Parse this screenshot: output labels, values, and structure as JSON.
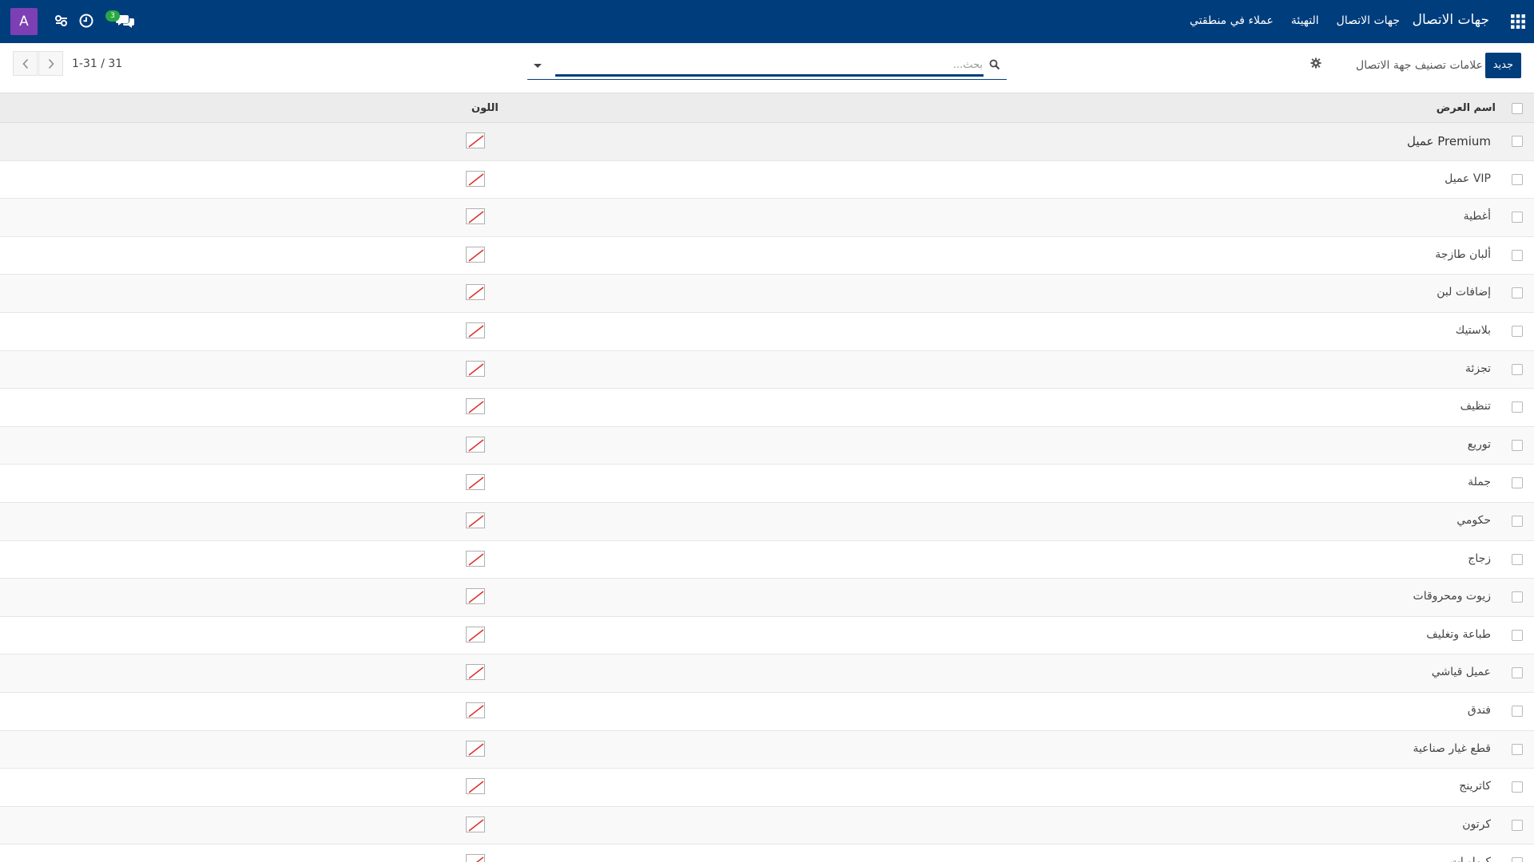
{
  "navbar": {
    "app_title": "جهات الاتصال",
    "menu": [
      {
        "label": "جهات الاتصال"
      },
      {
        "label": "التهيئة"
      },
      {
        "label": "عملاء في منطقتي"
      }
    ],
    "user_initial": "A",
    "chat_badge_count": "3",
    "icons": [
      "apps-grid-icon",
      "chat-icon",
      "clock-icon",
      "sliders-icon"
    ]
  },
  "control_panel": {
    "new_button": "جديد",
    "breadcrumb": "علامات تصنيف جهة الاتصال",
    "search_placeholder": "بحث...",
    "pager_text": "1-31 / 31"
  },
  "list": {
    "columns": {
      "display_name": "اسم العرض",
      "color": "اللون"
    },
    "rows": [
      {
        "name": "عميل Premium"
      },
      {
        "name": "عميل VIP"
      },
      {
        "name": "أغطية"
      },
      {
        "name": "ألبان طازجة"
      },
      {
        "name": "إضافات لبن"
      },
      {
        "name": "بلاستيك"
      },
      {
        "name": "تجزئة"
      },
      {
        "name": "تنظيف"
      },
      {
        "name": "توريع"
      },
      {
        "name": "جملة"
      },
      {
        "name": "حكومي"
      },
      {
        "name": "زجاج"
      },
      {
        "name": "زيوت ومحروقات"
      },
      {
        "name": "طباعة وتغليف"
      },
      {
        "name": "عميل قياشي"
      },
      {
        "name": "فندق"
      },
      {
        "name": "قطع غيار صناعية"
      },
      {
        "name": "كاترينج"
      },
      {
        "name": "كرتون"
      },
      {
        "name": "كيماويات"
      }
    ]
  },
  "colors": {
    "navbar_bg": "#003d7c",
    "avatar_bg": "#7c3fb4",
    "badge_bg": "#28a745",
    "swatch_slash": "#d9302c"
  }
}
